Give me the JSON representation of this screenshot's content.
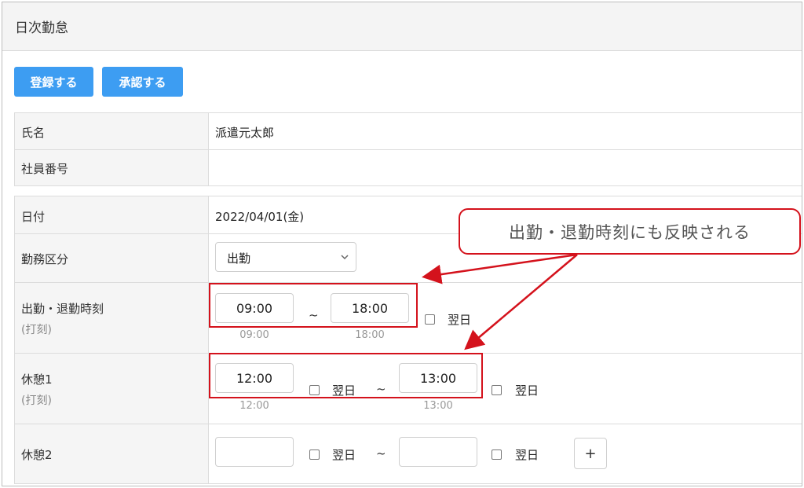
{
  "page": {
    "title": "日次勤怠"
  },
  "toolbar": {
    "register_label": "登録する",
    "approve_label": "承認する"
  },
  "employee": {
    "name_label": "氏名",
    "name_value": "派遣元太郎",
    "number_label": "社員番号",
    "number_value": ""
  },
  "attendance": {
    "date_label": "日付",
    "date_value": "2022/04/01(金)",
    "work_type_label": "勤務区分",
    "work_type_value": "出勤",
    "times_label": "出勤・退勤時刻",
    "times_sub": "(打刻)",
    "start": "09:00",
    "end": "18:00",
    "start_stamp": "09:00",
    "end_stamp": "18:00",
    "next_day_label": "翌日",
    "tilde": "~",
    "break1_label": "休憩1",
    "break1_sub": "(打刻)",
    "break1_start": "12:00",
    "break1_end": "13:00",
    "break1_start_stamp": "12:00",
    "break1_end_stamp": "13:00",
    "break2_label": "休憩2",
    "break2_start": "",
    "break2_end": "",
    "add_label": "+"
  },
  "annotation": {
    "callout_text": "出勤・退勤時刻にも反映される",
    "color": "#d4121c"
  }
}
